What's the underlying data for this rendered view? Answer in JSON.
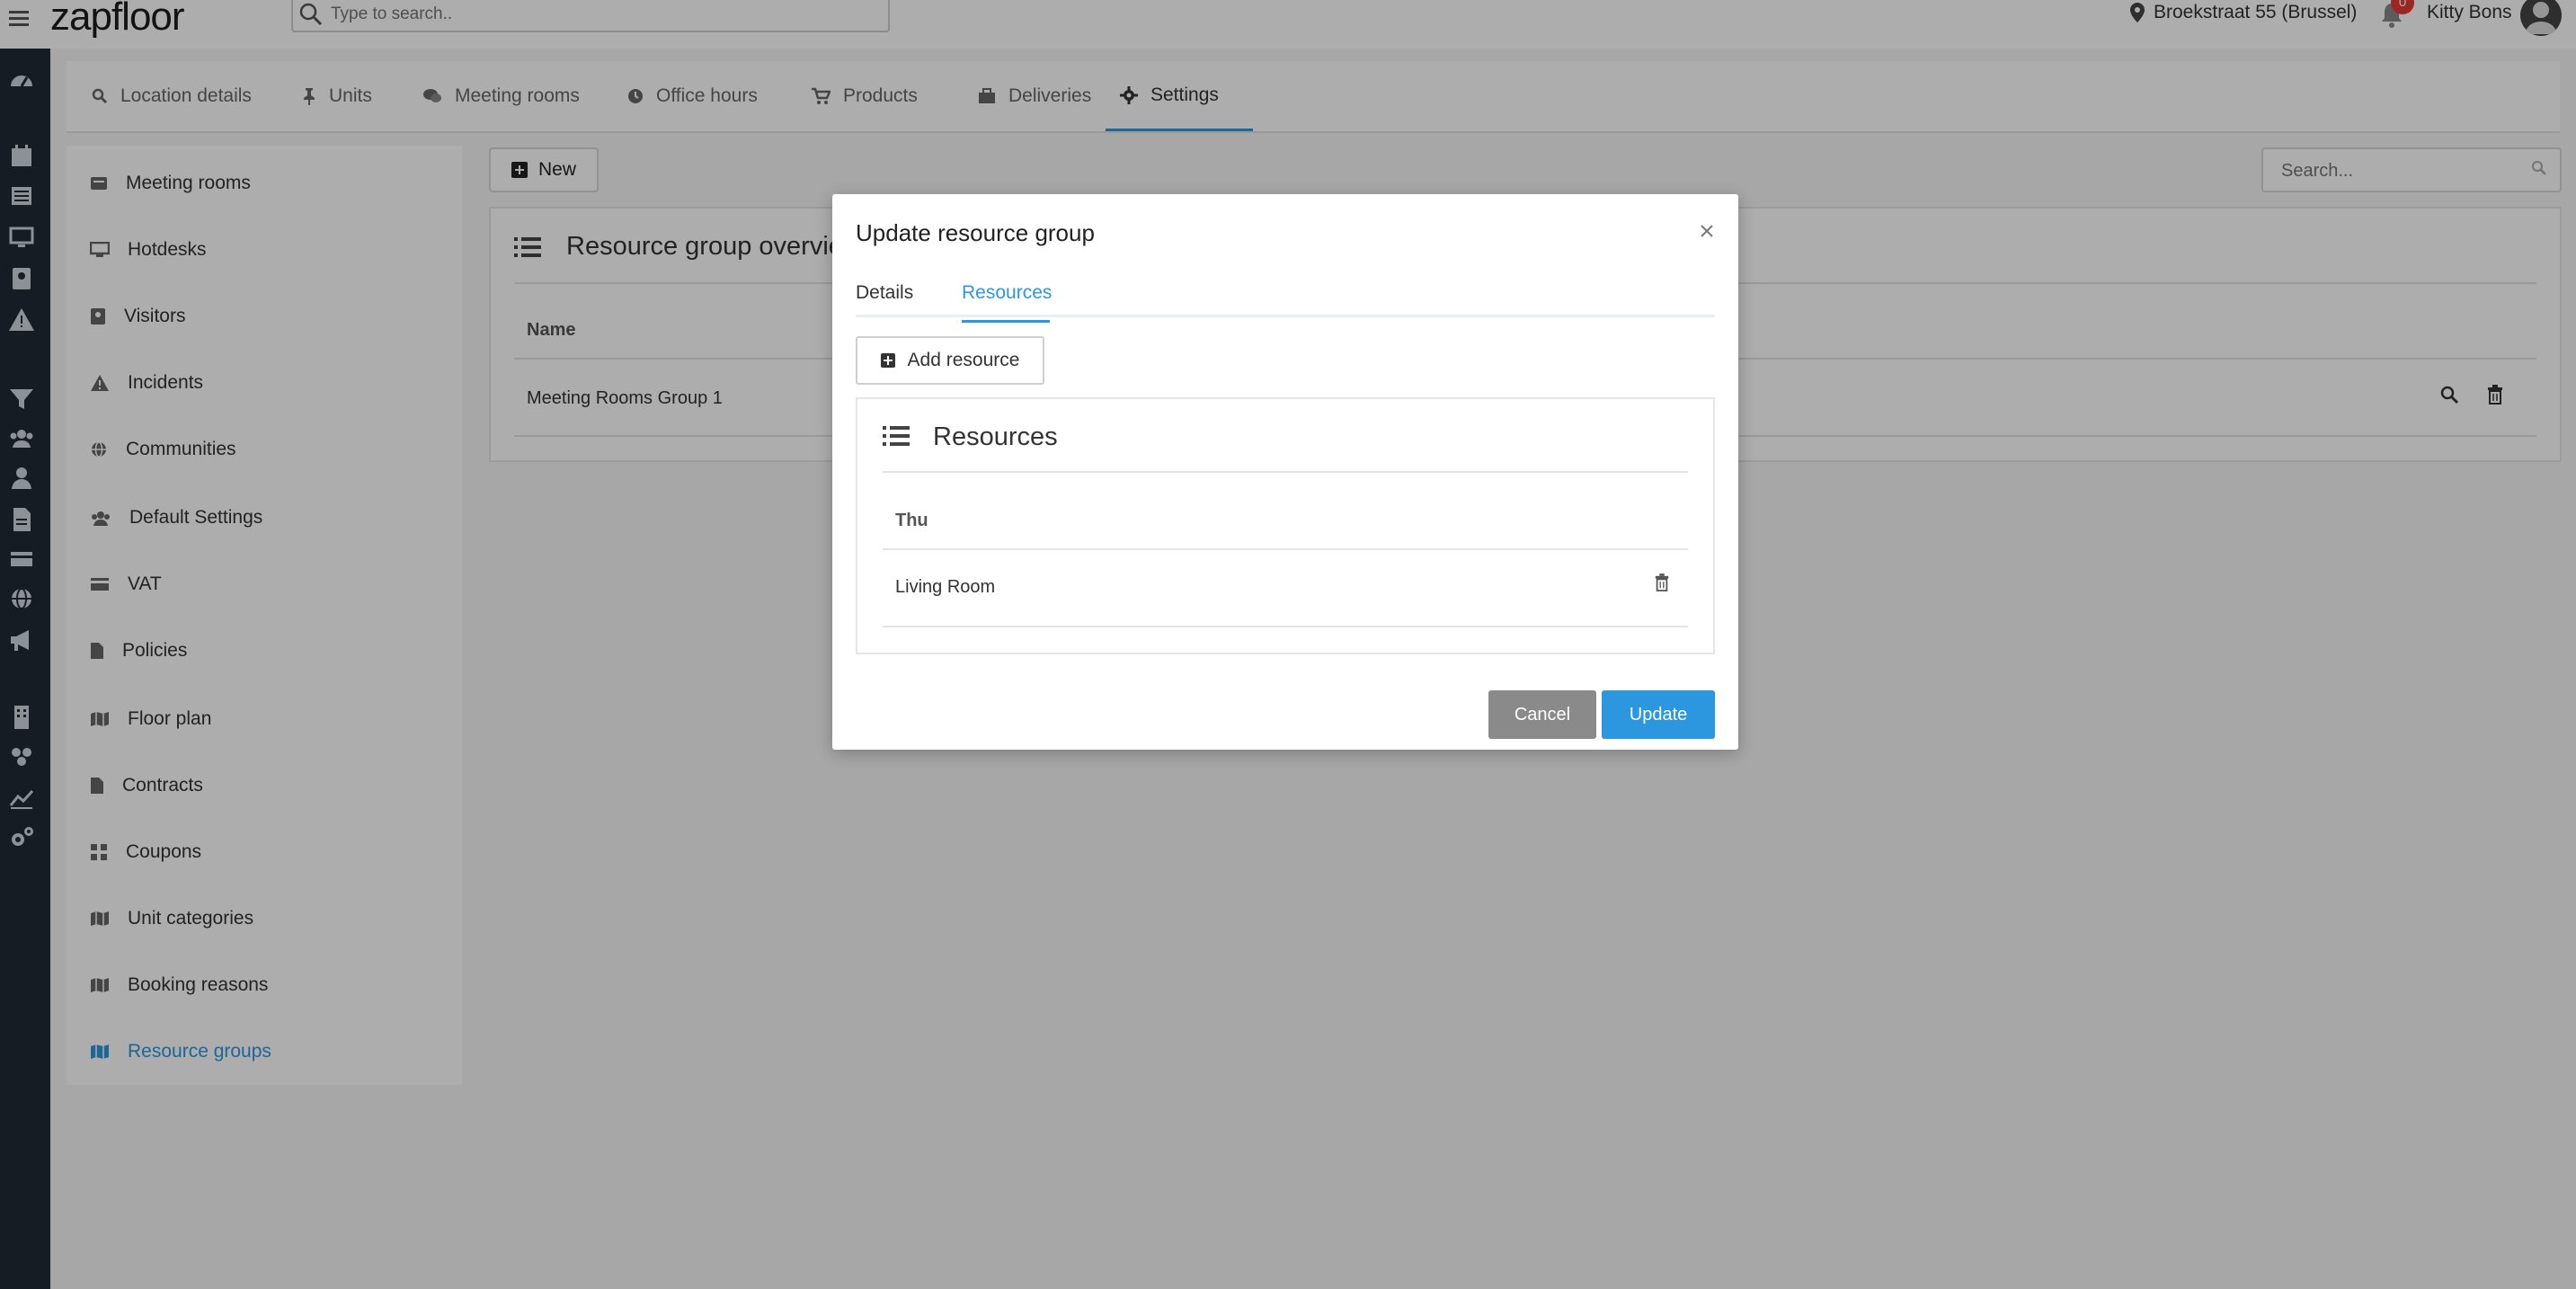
{
  "header": {
    "logo": "zapfloor",
    "search_placeholder": "Type to search..",
    "location": "Broekstraat 55 (Brussel)",
    "notifications_count": "0",
    "user_name": "Kitty Bons"
  },
  "rail_icons": [
    "dashboard-icon",
    "calendar-icon",
    "list-icon",
    "monitor-icon",
    "contacts-icon",
    "warning-icon",
    "filter-icon",
    "users-icon",
    "user-icon",
    "document-icon",
    "card-icon",
    "globe-icon",
    "megaphone-icon",
    "building-icon",
    "group-icon",
    "chart-icon",
    "settings-icon"
  ],
  "tabs": [
    {
      "label": "Location details",
      "icon": "search-icon"
    },
    {
      "label": "Units",
      "icon": "pin-icon"
    },
    {
      "label": "Meeting rooms",
      "icon": "chat-icon"
    },
    {
      "label": "Office hours",
      "icon": "clock-icon"
    },
    {
      "label": "Products",
      "icon": "cart-icon"
    },
    {
      "label": "Deliveries",
      "icon": "briefcase-icon"
    },
    {
      "label": "Settings",
      "icon": "gear-icon",
      "active": true
    }
  ],
  "sidebar": {
    "items": [
      {
        "label": "Meeting rooms",
        "icon": "meeting-room-icon"
      },
      {
        "label": "Hotdesks",
        "icon": "monitor-icon"
      },
      {
        "label": "Visitors",
        "icon": "contact-card-icon"
      },
      {
        "label": "Incidents",
        "icon": "warning-icon"
      },
      {
        "label": "Communities",
        "icon": "globe-icon"
      },
      {
        "label": "Default Settings",
        "icon": "users-icon"
      },
      {
        "label": "VAT",
        "icon": "credit-card-icon"
      },
      {
        "label": "Policies",
        "icon": "file-icon"
      },
      {
        "label": "Floor plan",
        "icon": "map-icon"
      },
      {
        "label": "Contracts",
        "icon": "file-icon"
      },
      {
        "label": "Coupons",
        "icon": "grid-icon"
      },
      {
        "label": "Unit categories",
        "icon": "map-icon"
      },
      {
        "label": "Booking reasons",
        "icon": "map-icon"
      },
      {
        "label": "Resource groups",
        "icon": "map-icon",
        "active": true
      }
    ]
  },
  "main": {
    "new_label": "New",
    "search_placeholder": "Search...",
    "overview_title": "Resource group overview",
    "column_name": "Name",
    "rows": [
      {
        "name": "Meeting Rooms Group 1"
      }
    ]
  },
  "modal": {
    "title": "Update resource group",
    "tabs": [
      "Details",
      "Resources"
    ],
    "active_tab": "Resources",
    "add_resource_label": "Add resource",
    "panel_title": "Resources",
    "column": "Thu",
    "rows": [
      {
        "name": "Living Room"
      }
    ],
    "cancel_label": "Cancel",
    "update_label": "Update"
  },
  "colors": {
    "accent": "#2c97de",
    "rail": "#1f2a36",
    "cancel": "#8a8a8a"
  }
}
